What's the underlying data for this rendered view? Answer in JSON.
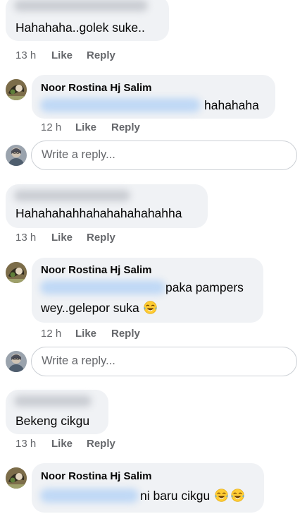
{
  "threads": [
    {
      "comment": {
        "text": "Hahahaha..golek suke..",
        "time": "13 h",
        "like": "Like",
        "reply": "Reply"
      },
      "reply": {
        "author": "Noor Rostina Hj Salim",
        "text_line1": "hahahaha",
        "time": "12 h",
        "like": "Like",
        "reply": "Reply"
      },
      "composer": {
        "placeholder": "Write a reply..."
      }
    },
    {
      "comment": {
        "text": "Hahahahahhahahahahahahha",
        "time": "13 h",
        "like": "Like",
        "reply": "Reply"
      },
      "reply": {
        "author": "Noor Rostina Hj Salim",
        "text_line1": "paka pampers",
        "text_line2": "wey..gelepor suka",
        "time": "12 h",
        "like": "Like",
        "reply": "Reply"
      },
      "composer": {
        "placeholder": "Write a reply..."
      }
    },
    {
      "comment": {
        "text": "Bekeng cikgu",
        "time": "13 h",
        "like": "Like",
        "reply": "Reply"
      },
      "reply": {
        "author": "Noor Rostina Hj Salim",
        "text_line1": "ni baru cikgu"
      }
    }
  ],
  "icons": {
    "emoji": "face-with-tears-of-joy-icon",
    "author_avatar": "avatar-icon",
    "user_avatar": "avatar-icon"
  },
  "colors": {
    "bubble": "#f0f2f5",
    "meta_text": "#65676b",
    "mention_blur": "#bfd8f5",
    "border": "#ccd0d5"
  }
}
